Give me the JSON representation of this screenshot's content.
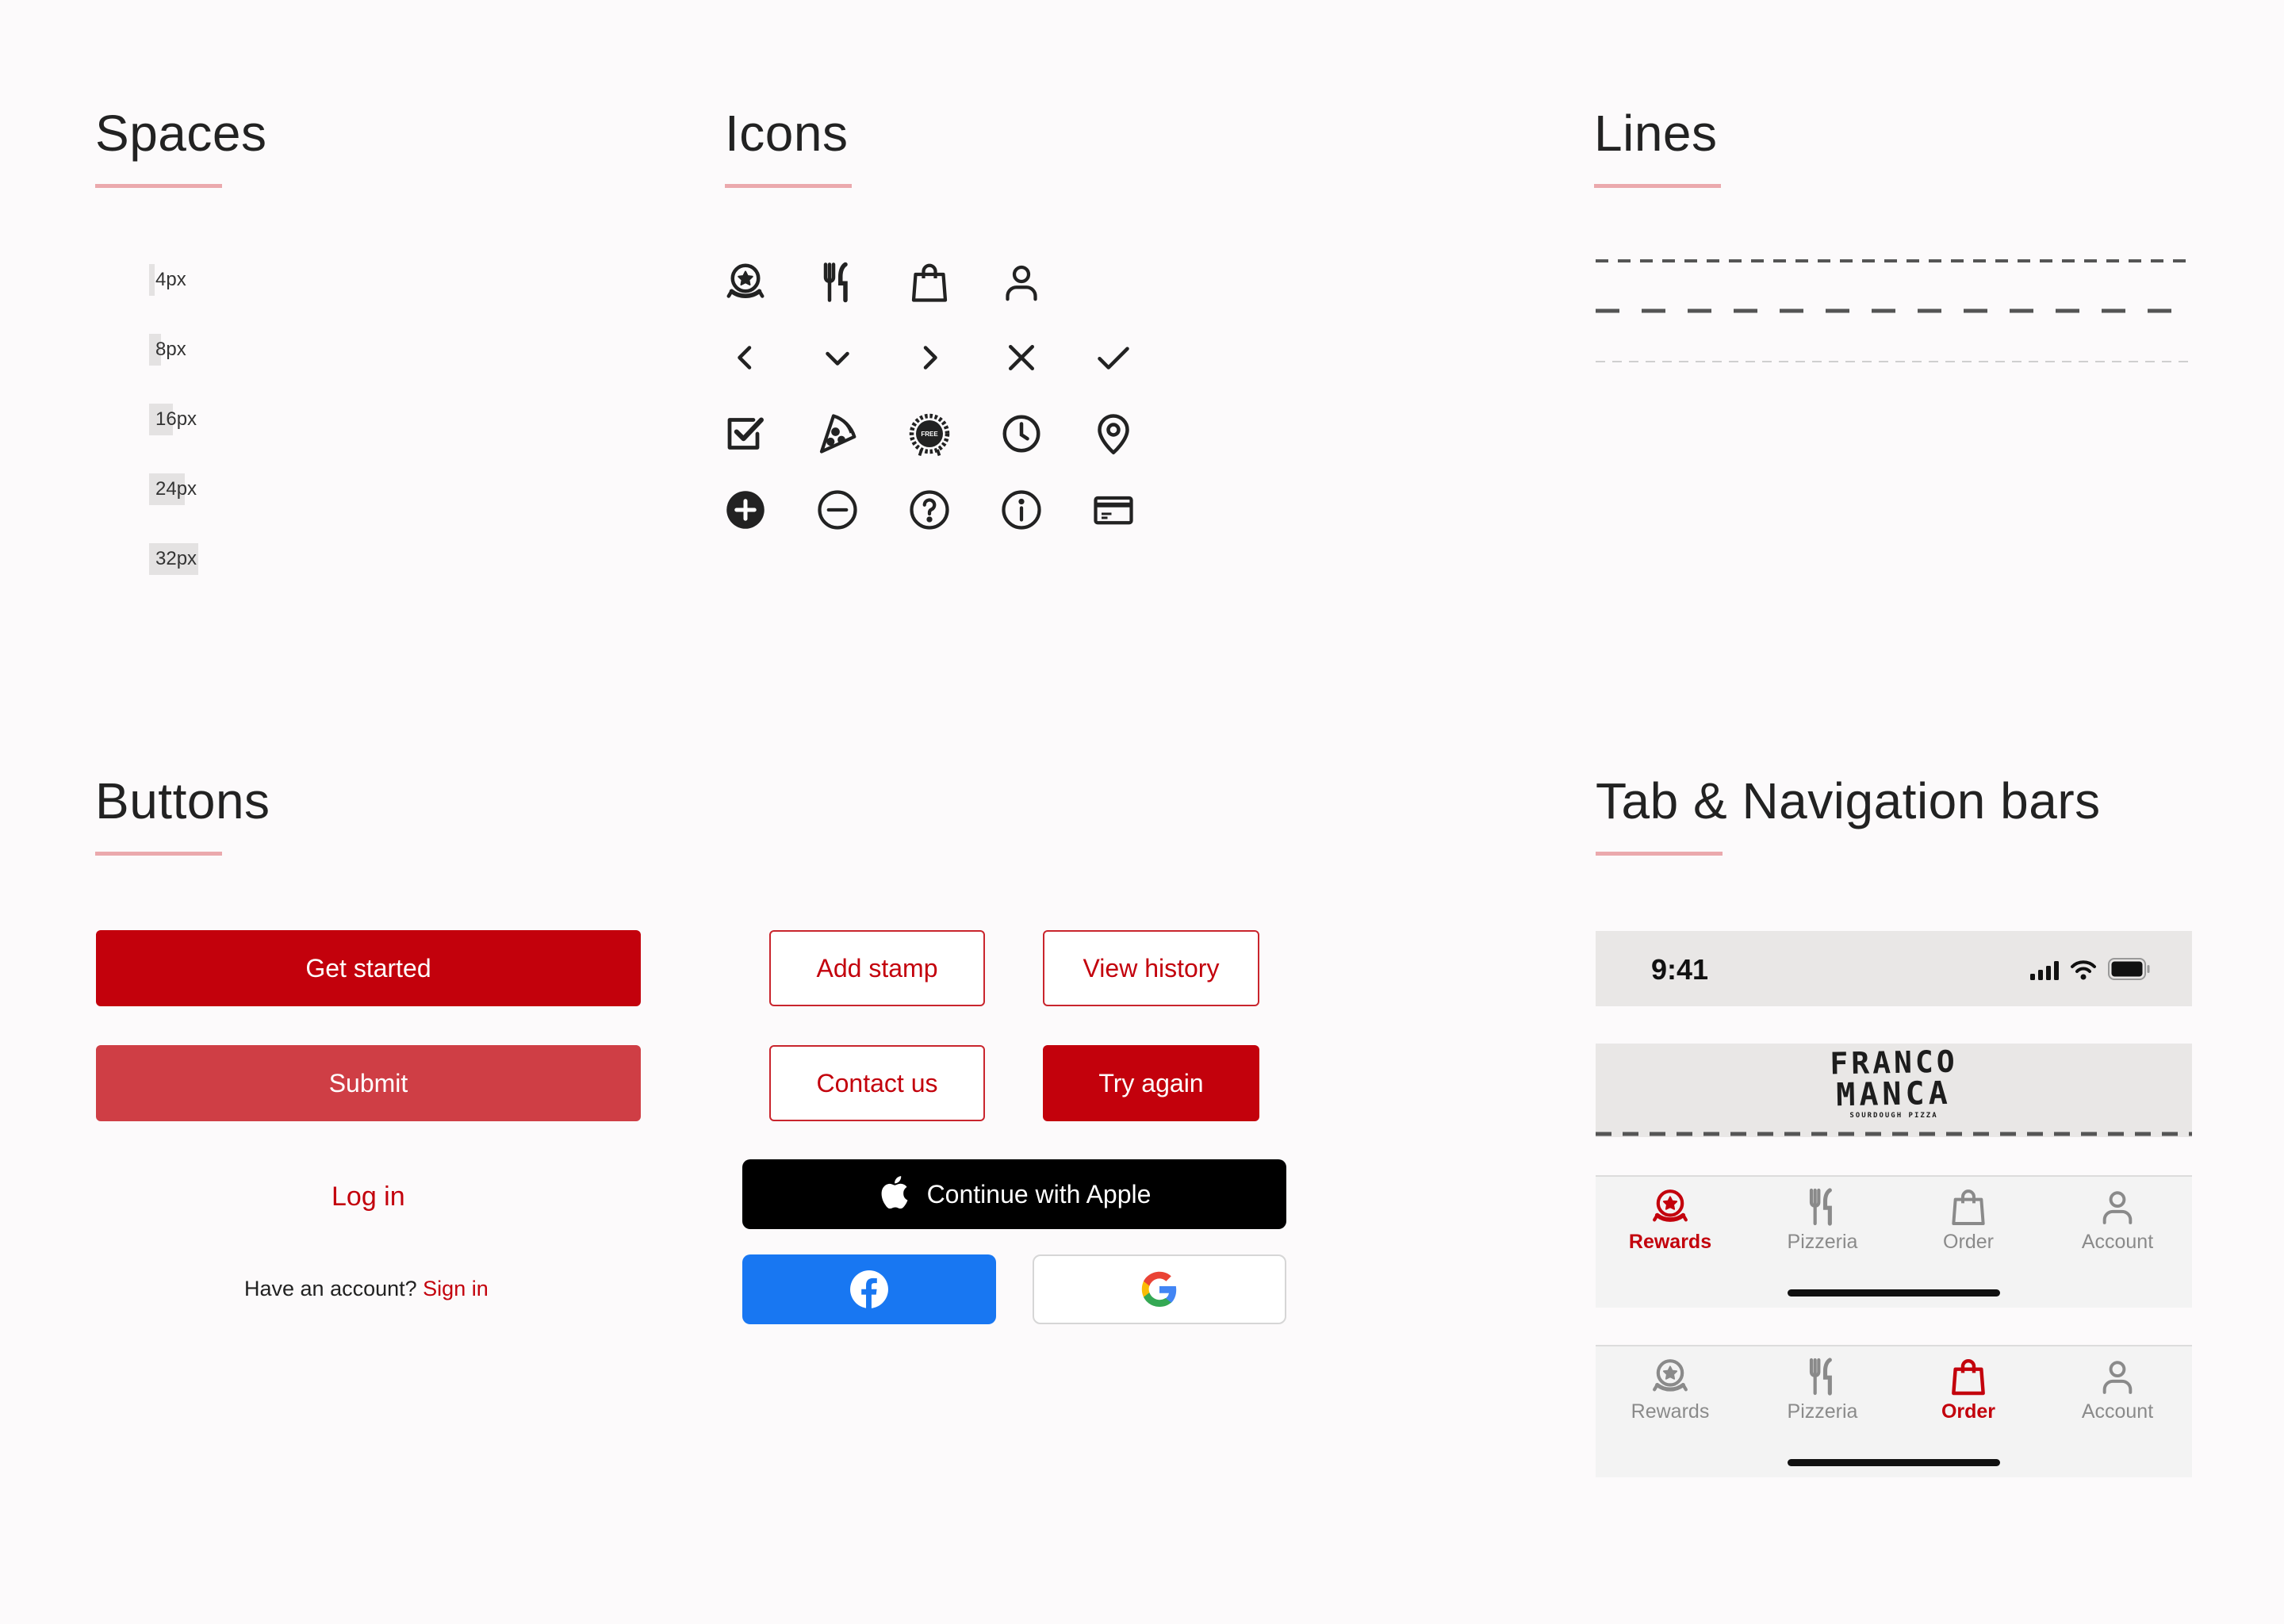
{
  "sections": {
    "spaces": "Spaces",
    "icons": "Icons",
    "lines": "Lines",
    "buttons": "Buttons",
    "tabs": "Tab & Navigation bars"
  },
  "spaces": [
    {
      "label": "4px"
    },
    {
      "label": "8px"
    },
    {
      "label": "16px"
    },
    {
      "label": "24px"
    },
    {
      "label": "32px"
    }
  ],
  "icons": [
    "rewards-icon",
    "cutlery-icon",
    "shopping-bag-icon",
    "user-icon",
    "chevron-left-icon",
    "chevron-down-icon",
    "chevron-right-icon",
    "close-icon",
    "check-icon",
    "checkbox-checked-icon",
    "pizza-slice-icon",
    "free-badge-icon",
    "clock-icon",
    "location-pin-icon",
    "plus-circle-icon",
    "minus-circle-icon",
    "question-circle-icon",
    "info-circle-icon",
    "credit-card-icon"
  ],
  "badge_text": "FREE",
  "buttons": {
    "get_started": "Get started",
    "submit": "Submit",
    "log_in": "Log in",
    "have_account": "Have an account?",
    "sign_in": "Sign in",
    "add_stamp": "Add stamp",
    "view_history": "View history",
    "contact_us": "Contact us",
    "try_again": "Try again",
    "continue_apple": "Continue with Apple"
  },
  "status_bar": {
    "time": "9:41"
  },
  "brand": {
    "line1": "FRANCO",
    "line2": "MANCA",
    "tagline": "SOURDOUGH PIZZA"
  },
  "tab_bar_1": {
    "active": "Rewards",
    "items": [
      {
        "label": "Rewards"
      },
      {
        "label": "Pizzeria"
      },
      {
        "label": "Order"
      },
      {
        "label": "Account"
      }
    ]
  },
  "tab_bar_2": {
    "active": "Order",
    "items": [
      {
        "label": "Rewards"
      },
      {
        "label": "Pizzeria"
      },
      {
        "label": "Order"
      },
      {
        "label": "Account"
      }
    ]
  },
  "colors": {
    "brand_red": "#c3010c",
    "secondary_red": "#cf3e45",
    "underline_pink": "#eba9ad",
    "facebook_blue": "#1877f2",
    "background": "#fcfafb"
  }
}
